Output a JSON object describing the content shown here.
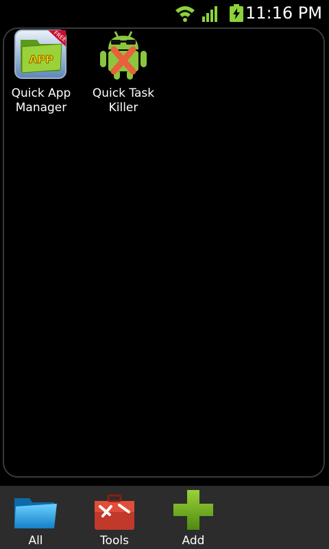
{
  "status_bar": {
    "time": "11:16 PM",
    "icons": [
      "wifi-icon",
      "signal-icon",
      "battery-charging-icon"
    ]
  },
  "apps": [
    {
      "label": "Quick App\nManager",
      "icon": "quick-app-manager-icon",
      "badge": "FREE"
    },
    {
      "label": "Quick Task\nKiller",
      "icon": "android-task-killer-icon"
    }
  ],
  "bottom_bar": {
    "items": [
      {
        "label": "All",
        "icon": "folder-icon"
      },
      {
        "label": "Tools",
        "icon": "toolbox-icon"
      },
      {
        "label": "Add",
        "icon": "plus-icon"
      }
    ]
  },
  "colors": {
    "background": "#000000",
    "bottom_bar": "#2c2c2c",
    "status_green": "#8cd23c"
  }
}
